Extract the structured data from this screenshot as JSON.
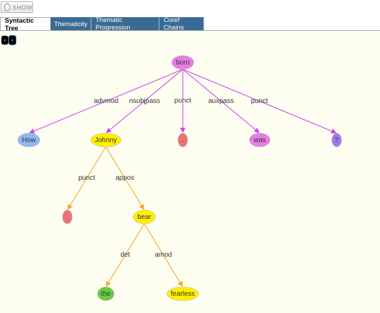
{
  "toolbar": {
    "show_label": "SHOW"
  },
  "tabs": [
    {
      "label": "Syntactic Tree",
      "active": true
    },
    {
      "label": "Thematicity",
      "active": false
    },
    {
      "label": "Thematic Progression",
      "active": false
    },
    {
      "label": "Coref Chains",
      "active": false
    }
  ],
  "nav": {
    "prev_icon": "chevron-left-icon",
    "next_icon": "chevron-right-icon"
  },
  "colors": {
    "panel_bg": "#fdfdf0",
    "tab_bg": "#3a6b94",
    "verb_node": "#e47ee4",
    "noun_node": "#ffef00",
    "adv_node": "#8fb8f0",
    "punct_node": "#f07078",
    "det_node": "#66cc44",
    "purple_node": "#a07ae8",
    "edge_magenta": "#cc44ee",
    "edge_orange": "#f5a623"
  },
  "tree": {
    "nodes": [
      {
        "id": "born",
        "label": "born"
      },
      {
        "id": "how",
        "label": "How"
      },
      {
        "id": "johnny",
        "label": "Johnny"
      },
      {
        "id": "p1",
        "label": "."
      },
      {
        "id": "was",
        "label": "was"
      },
      {
        "id": "p2",
        "label": "?"
      },
      {
        "id": "p3",
        "label": ","
      },
      {
        "id": "bear",
        "label": "bear"
      },
      {
        "id": "the",
        "label": "the"
      },
      {
        "id": "fearless",
        "label": "fearless"
      }
    ],
    "edges": [
      {
        "from": "born",
        "to": "how",
        "label": "advmod"
      },
      {
        "from": "born",
        "to": "johnny",
        "label": "nsubjpass"
      },
      {
        "from": "born",
        "to": "p1",
        "label": "punct"
      },
      {
        "from": "born",
        "to": "was",
        "label": "auxpass"
      },
      {
        "from": "born",
        "to": "p2",
        "label": "punct"
      },
      {
        "from": "johnny",
        "to": "p3",
        "label": "punct"
      },
      {
        "from": "johnny",
        "to": "bear",
        "label": "appos"
      },
      {
        "from": "bear",
        "to": "the",
        "label": "det"
      },
      {
        "from": "bear",
        "to": "fearless",
        "label": "amod"
      }
    ]
  }
}
